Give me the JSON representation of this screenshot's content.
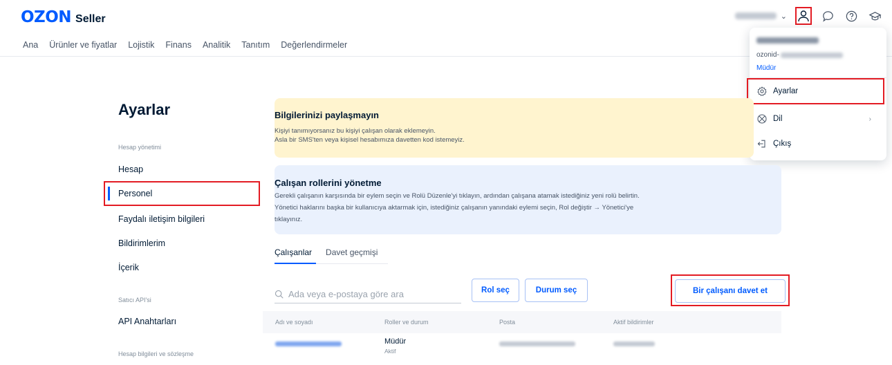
{
  "brand": {
    "logo": "OZON",
    "product": "Seller"
  },
  "nav": [
    "Ana",
    "Ürünler ve fiyatlar",
    "Lojistik",
    "Finans",
    "Analitik",
    "Tanıtım",
    "Değerlendirmeler"
  ],
  "dropdown": {
    "id_prefix": "ozonid-",
    "role": "Müdür",
    "items": [
      {
        "label": "Ayarlar",
        "icon": "gear-icon"
      },
      {
        "label": "Dil",
        "icon": "globe-icon"
      },
      {
        "label": "Çıkış",
        "icon": "logout-icon"
      }
    ]
  },
  "sidebar": {
    "title": "Ayarlar",
    "group1": "Hesap yönetimi",
    "items1": [
      "Hesap",
      "Personel",
      "Faydalı iletişim bilgileri",
      "Bildirimlerim",
      "İçerik"
    ],
    "group2": "Satıcı API'si",
    "items2": [
      "API Anahtarları"
    ],
    "group3": "Hesap bilgileri ve sözleşme"
  },
  "warning": {
    "title": "Bilgilerinizi paylaşmayın",
    "line1": "Kişiyi tanımıyorsanız bu kişiyi çalışan olarak eklemeyin.",
    "line2": "Asla bir SMS'ten veya kişisel hesabımıza davetten kod istemeyiz."
  },
  "info": {
    "title": "Çalışan rollerini yönetme",
    "line1": "Gerekli çalışanın karşısında bir eylem seçin ve Rolü Düzenle'yi tıklayın, ardından çalışana atamak istediğiniz yeni rolü belirtin.",
    "line2": "Yönetici haklarını başka bir kullanıcıya aktarmak için, istediğiniz çalışanın yanındaki eylemi seçin, Rol değiştir → Yönetici'ye",
    "line3": "tıklayınız."
  },
  "tabs": [
    "Çalışanlar",
    "Davet geçmişi"
  ],
  "search": {
    "placeholder": "Ada veya e-postaya göre ara"
  },
  "buttons": {
    "role": "Rol seç",
    "status": "Durum seç",
    "invite": "Bir çalışanı davet et"
  },
  "table": {
    "headers": [
      "Adı ve soyadı",
      "Roller ve durum",
      "Posta",
      "Aktif bildirimler"
    ],
    "row": {
      "role": "Müdür",
      "status": "Aktif"
    }
  },
  "colors": {
    "accent": "#005bff",
    "highlight": "#e31b23",
    "warning_bg": "#fff4cf",
    "info_bg": "#eaf1fd"
  }
}
